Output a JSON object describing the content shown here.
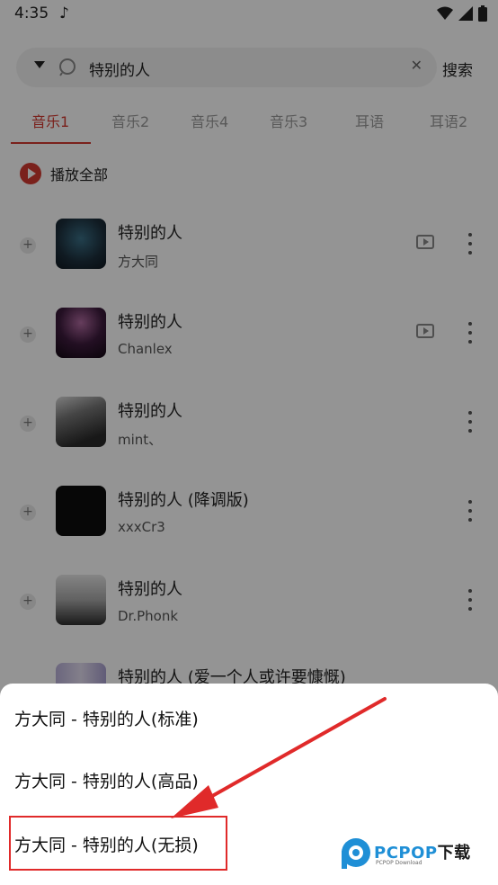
{
  "status_bar": {
    "time": "4:35",
    "music_icon": "music-note-icon",
    "wifi_icon": "wifi-icon",
    "signal_icon": "signal-icon",
    "battery_icon": "battery-icon"
  },
  "search": {
    "query": "特别的人",
    "button_label": "搜索"
  },
  "tabs": [
    "音乐1",
    "音乐2",
    "音乐4",
    "音乐3",
    "耳语",
    "耳语2"
  ],
  "play_all": {
    "label": "播放全部"
  },
  "songs": [
    {
      "title": "特别的人",
      "artist": "方大同",
      "has_mv": true
    },
    {
      "title": "特别的人",
      "artist": "Chanlex",
      "has_mv": true
    },
    {
      "title": "特别的人",
      "artist": "mint、",
      "has_mv": false
    },
    {
      "title": "特别的人 (降调版)",
      "artist": "xxxCr3",
      "has_mv": false
    },
    {
      "title": "特别的人",
      "artist": "Dr.Phonk",
      "has_mv": false
    },
    {
      "title": "特别的人 (爱一个人或许要慷慨)",
      "artist": "",
      "has_mv": false
    }
  ],
  "quality_sheet": {
    "options": [
      "方大同 - 特别的人(标准)",
      "方大同 - 特别的人(高品)",
      "方大同 - 特别的人(无损)"
    ],
    "highlighted_index": 2
  },
  "watermark": {
    "brand": "PCPOP",
    "suffix": "下载",
    "sub": "PCPOP Download"
  },
  "colors": {
    "accent": "#d33a31",
    "annotation": "#e02a2a",
    "watermark_blue": "#1f8fd6"
  }
}
